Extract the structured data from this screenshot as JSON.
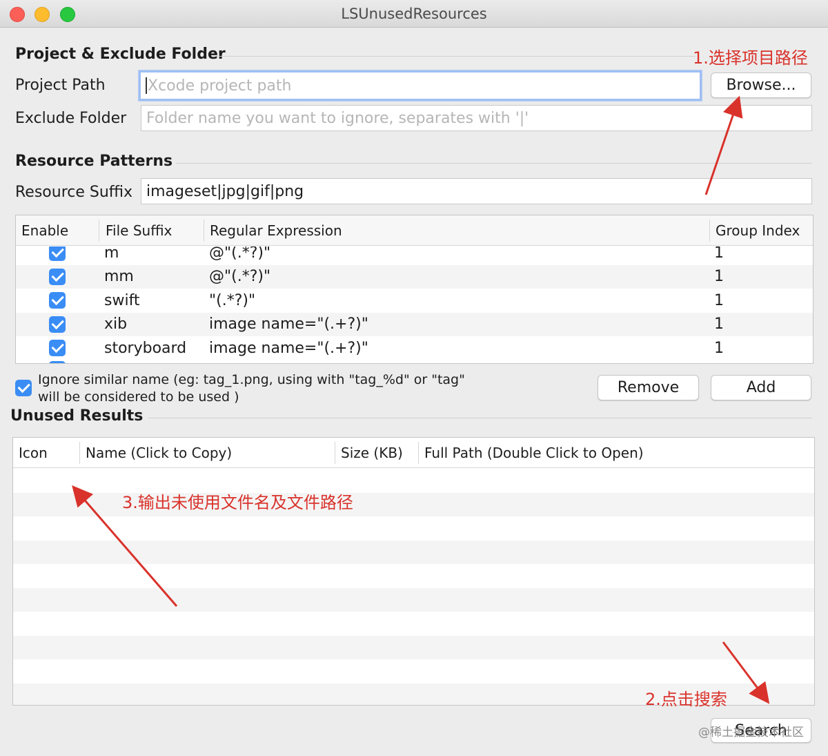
{
  "window": {
    "title": "LSUnusedResources"
  },
  "project": {
    "section_title": "Project & Exclude Folder",
    "project_path_label": "Project Path",
    "project_path_placeholder": "Xcode project path",
    "browse_label": "Browse...",
    "exclude_label": "Exclude Folder",
    "exclude_placeholder": "Folder name you want to ignore, separates with '|'"
  },
  "patterns": {
    "section_title": "Resource Patterns",
    "suffix_label": "Resource Suffix",
    "suffix_value": "imageset|jpg|gif|png",
    "columns": [
      "Enable",
      "File Suffix",
      "Regular Expression",
      "Group Index"
    ],
    "rows": [
      {
        "enabled": true,
        "suffix": "m",
        "regex": "@\"(.*?)\"",
        "group": "1"
      },
      {
        "enabled": true,
        "suffix": "mm",
        "regex": "@\"(.*?)\"",
        "group": "1"
      },
      {
        "enabled": true,
        "suffix": "swift",
        "regex": "\"(.*?)\"",
        "group": "1"
      },
      {
        "enabled": true,
        "suffix": "xib",
        "regex": "image name=\"(.+?)\"",
        "group": "1"
      },
      {
        "enabled": true,
        "suffix": "storyboard",
        "regex": "image name=\"(.+?)\"",
        "group": "1"
      }
    ],
    "ignore_similar_line1": "Ignore similar name (eg: tag_1.png, using with \"tag_%d\" or \"tag\"",
    "ignore_similar_line2": "will be considered to be used )",
    "ignore_similar_checked": true,
    "remove_label": "Remove",
    "add_label": "Add"
  },
  "results": {
    "section_title": "Unused Results",
    "columns": [
      "Icon",
      "Name (Click to Copy)",
      "Size (KB)",
      "Full Path (Double Click to Open)"
    ],
    "search_label": "Search"
  },
  "annotations": {
    "step1": "1.选择项目路径",
    "step2": "2.点击搜索",
    "step3": "3.输出未使用文件名及文件路径",
    "watermark": "@稀土掘金技术社区",
    "color": "#d9322b"
  }
}
